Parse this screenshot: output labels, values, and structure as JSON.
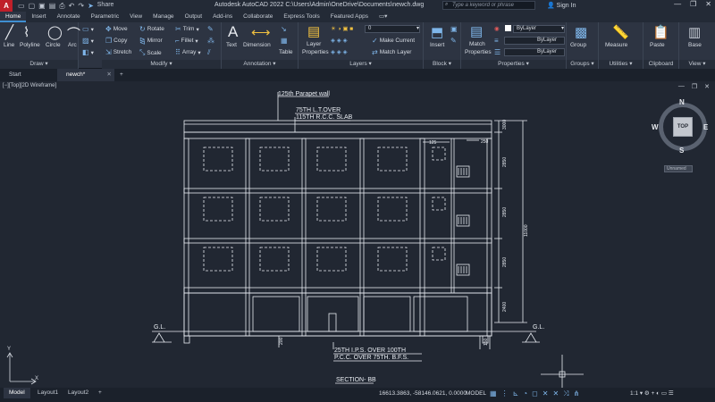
{
  "titlebar": {
    "app_logo": "A",
    "title": "Autodesk AutoCAD 2022    C:\\Users\\Admin\\OneDrive\\Documents\\newch.dwg",
    "share": "Share",
    "search_placeholder": "Type a keyword or phrase",
    "signin": "Sign In"
  },
  "ribbon_tabs": [
    "Home",
    "Insert",
    "Annotate",
    "Parametric",
    "View",
    "Manage",
    "Output",
    "Add-ins",
    "Collaborate",
    "Express Tools",
    "Featured Apps"
  ],
  "ribbon": {
    "draw": {
      "label": "Draw",
      "line": "Line",
      "polyline": "Polyline",
      "circle": "Circle",
      "arc": "Arc"
    },
    "modify": {
      "label": "Modify",
      "move": "Move",
      "rotate": "Rotate",
      "trim": "Trim",
      "copy": "Copy",
      "mirror": "Mirror",
      "fillet": "Fillet",
      "stretch": "Stretch",
      "scale": "Scale",
      "array": "Array"
    },
    "annotation": {
      "label": "Annotation",
      "text": "Text",
      "dimension": "Dimension",
      "table": "Table"
    },
    "layers": {
      "label": "Layers",
      "layer_properties_1": "Layer",
      "layer_properties_2": "Properties",
      "current_layer": "0",
      "make_current": "Make Current",
      "match_layer": "Match Layer"
    },
    "block": {
      "label": "Block",
      "insert": "Insert"
    },
    "properties": {
      "label": "Properties",
      "match_1": "Match",
      "match_2": "Properties",
      "color": "ByLayer",
      "linetype": "ByLayer",
      "lineweight": "ByLayer"
    },
    "groups": {
      "label": "Groups",
      "group": "Group"
    },
    "utilities": {
      "label": "Utilities",
      "measure": "Measure"
    },
    "clipboard": {
      "label": "Clipboard",
      "paste": "Paste"
    },
    "view": {
      "label": "View",
      "base": "Base"
    }
  },
  "file_tabs": {
    "start": "Start",
    "active": "newch*",
    "add": "+"
  },
  "viewport": {
    "label": "[−][Top][2D Wireframe]",
    "viewcube": {
      "top": "TOP",
      "n": "N",
      "s": "S",
      "e": "E",
      "w": "W",
      "wcs": "Unnamed"
    }
  },
  "drawing": {
    "annotations": {
      "parapet": "125th Parapet wall",
      "lt_over": "75TH L.T.OVER",
      "rcc_slab": "115TH R.C.C. SLAB",
      "ips": "25TH I.P.S. OVER 100TH",
      "pcc": "P.C.C.         OVER 75TH. B.F.S.",
      "section": "SECTION- BB",
      "gl_left": "G.L.",
      "gl_right": "G.L."
    },
    "dimensions": {
      "d125": "125",
      "d250": "250",
      "d3000": "3000",
      "d2850_1": "2850",
      "d2850_2": "2850",
      "d2850_3": "2850",
      "d2400": "2400",
      "d11000": "11000",
      "d200": "200",
      "d150": "150"
    }
  },
  "statusbar": {
    "model_tab": "Model",
    "layout1": "Layout1",
    "layout2": "Layout2",
    "coords": "16613.3863, -58146.0621, 0.0000",
    "model": "MODEL",
    "scale": "1:1"
  }
}
